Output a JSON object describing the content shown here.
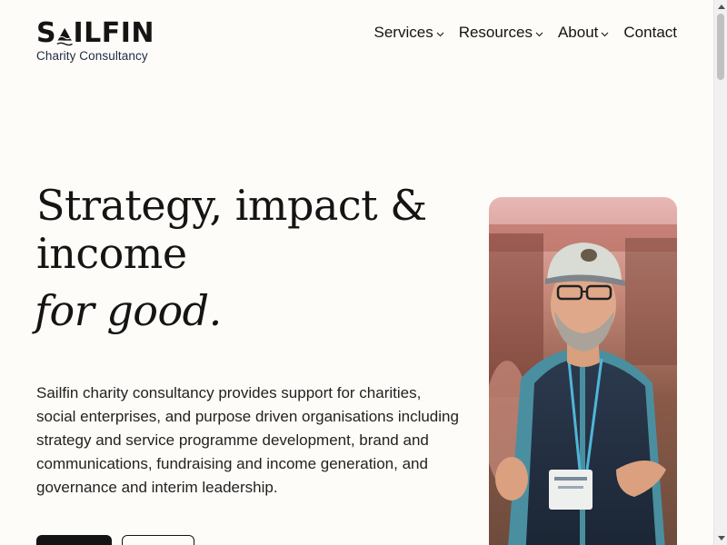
{
  "brand": {
    "name": "SAILFIN",
    "tagline": "Charity Consultancy"
  },
  "nav": {
    "items": [
      {
        "label": "Services",
        "dropdown": true
      },
      {
        "label": "Resources",
        "dropdown": true
      },
      {
        "label": "About",
        "dropdown": true
      },
      {
        "label": "Contact",
        "dropdown": false
      }
    ]
  },
  "hero": {
    "title": "Strategy, impact & income",
    "title_italic": "for good.",
    "body": "Sailfin charity consultancy provides support for charities, social enterprises, and purpose driven organisations including strategy and service programme development, brand and communications, fundraising and income generation, and governance and interim leadership."
  },
  "colors": {
    "background": "#fdfcf8",
    "text": "#141414",
    "tagline": "#1f2a44",
    "button_primary": "#141414"
  },
  "icons": {
    "nav_dropdown": "chevron-down-icon",
    "logo_mark": "sail-wave-icon"
  }
}
